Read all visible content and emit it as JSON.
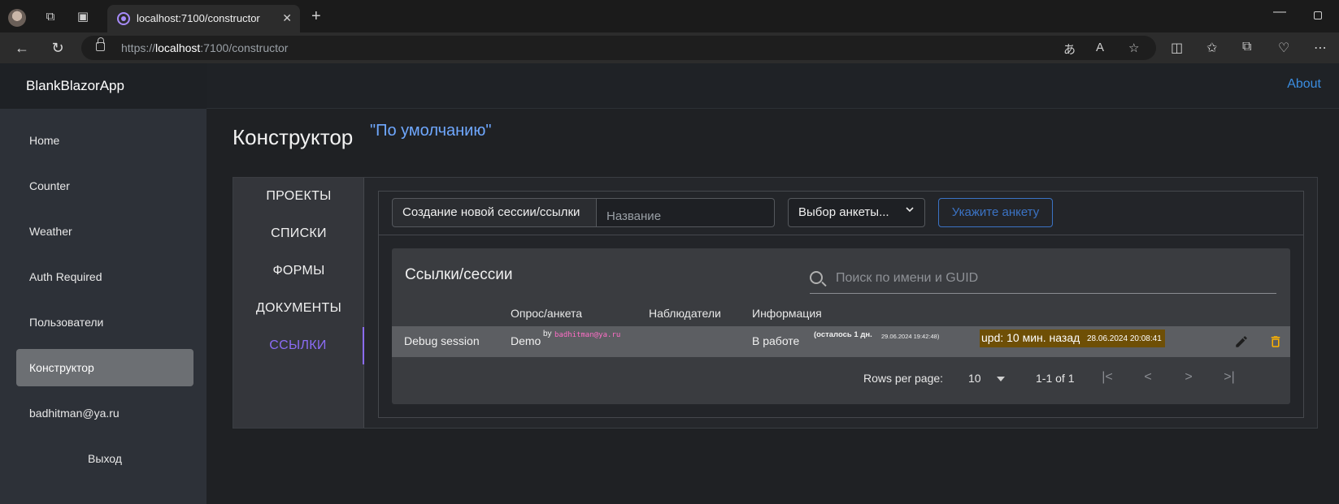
{
  "browser": {
    "tab_title": "localhost:7100/constructor",
    "url_prefix": "https://",
    "url_host": "localhost",
    "url_path": ":7100/constructor"
  },
  "app": {
    "brand": "BlankBlazorApp",
    "about": "About"
  },
  "sidebar": {
    "items": [
      {
        "label": "Home"
      },
      {
        "label": "Counter"
      },
      {
        "label": "Weather"
      },
      {
        "label": "Auth Required"
      },
      {
        "label": "Пользователи"
      },
      {
        "label": "Конструктор"
      },
      {
        "label": "badhitman@ya.ru"
      },
      {
        "label": "Выход"
      }
    ]
  },
  "page": {
    "title": "Конструктор",
    "subtitle": "\"По умолчанию\""
  },
  "vtabs": [
    {
      "label": "ПРОЕКТЫ"
    },
    {
      "label": "СПИСКИ"
    },
    {
      "label": "ФОРМЫ"
    },
    {
      "label": "ДОКУМЕНТЫ"
    },
    {
      "label": "ССЫЛКИ"
    }
  ],
  "controls": {
    "create_label": "Создание новой сессии/ссылки",
    "name_placeholder": "Название",
    "select_value": "Выбор анкеты...",
    "specify_button": "Укажите анкету"
  },
  "table": {
    "title": "Ссылки/сессии",
    "search_placeholder": "Поиск по имени и GUID",
    "headers": [
      "Опрос/анкета",
      "Наблюдатели",
      "Информация"
    ],
    "rows": [
      {
        "name": "Debug session",
        "survey": "Demo",
        "by": "by",
        "email": "badhitman@ya.ru",
        "status": "В работе",
        "remaining": "(осталось 1 дн.",
        "deadline": "29.06.2024 19:42:48)",
        "updated": "upd: 10 мин. назад",
        "updated_date": "28.06.2024 20:08:41"
      }
    ],
    "pager": {
      "rows_per_page_label": "Rows per page:",
      "rows_per_page_value": "10",
      "range": "1-1 of 1"
    }
  },
  "colors": {
    "accent_purple": "#8b6cf5",
    "link_blue": "#3b8de0",
    "upd_badge": "#6e4f06",
    "email_pink": "#ff6ec7",
    "delete_orange": "#ffb300"
  }
}
